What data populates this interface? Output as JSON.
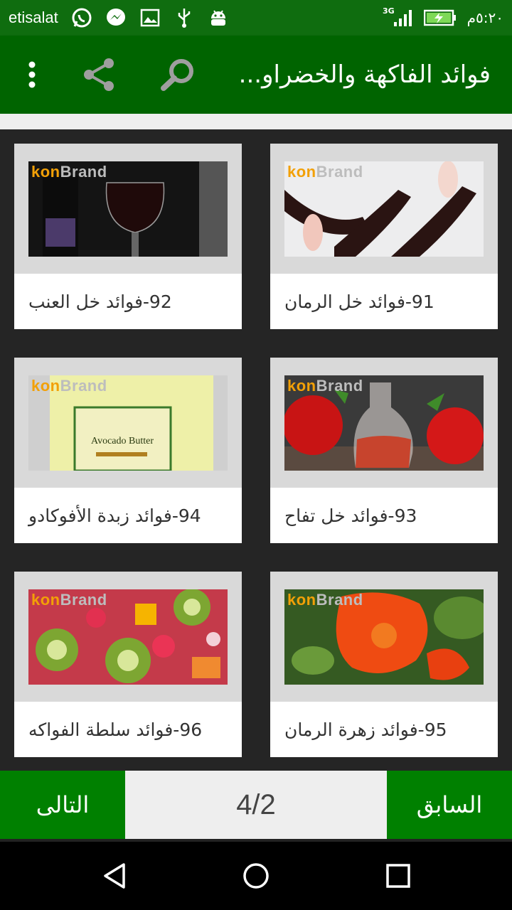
{
  "status_bar": {
    "carrier": "etisalat",
    "network": "3G",
    "time": "٥:٢٠م",
    "icons": [
      "whatsapp-icon",
      "messenger-icon",
      "gallery-icon",
      "usb-icon",
      "android-icon",
      "signal-icon",
      "battery-charging-icon"
    ]
  },
  "app_bar": {
    "title": "فوائد الفاكهة والخضراو...",
    "icons": [
      "overflow-menu-icon",
      "share-icon",
      "search-icon"
    ]
  },
  "watermark": {
    "part1": "kon",
    "part2": "Brand"
  },
  "items": [
    {
      "label": "91-فوائد خل الرمان"
    },
    {
      "label": "92-فوائد خل العنب"
    },
    {
      "label": "93-فوائد خل تفاح"
    },
    {
      "label": "94-فوائد زبدة الأفوكادو"
    },
    {
      "label": "95-فوائد زهرة الرمان"
    },
    {
      "label": "96-فوائد سلطة الفواكه"
    }
  ],
  "thumb_text": {
    "avocado_label": "Avocado Butter"
  },
  "pager": {
    "next_label": "التالى",
    "prev_label": "السابق",
    "page_indicator": "4/2"
  },
  "nav_bar": {
    "icons": [
      "back-icon",
      "home-icon",
      "recents-icon"
    ]
  },
  "colors": {
    "status_bar": "#0f6d0f",
    "app_bar": "#006400",
    "pager_button": "#008000",
    "background": "#252525",
    "watermark_orange": "#f2a007"
  }
}
